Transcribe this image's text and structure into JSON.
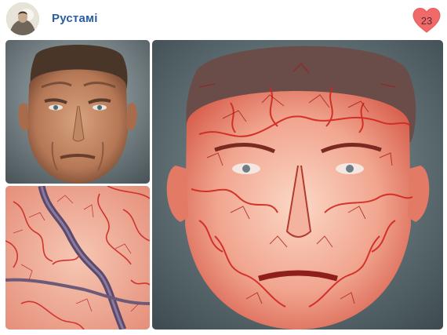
{
  "post": {
    "author": {
      "name": "Рустамі",
      "avatar_icon": "profile-photo"
    },
    "likes": {
      "count": "23",
      "icon": "heart-icon",
      "color": "#f06a6a"
    }
  },
  "gallery": {
    "images": [
      {
        "subject": "portrait-photo"
      },
      {
        "subject": "vein-texture"
      },
      {
        "subject": "stylized-vein-portrait"
      }
    ]
  }
}
